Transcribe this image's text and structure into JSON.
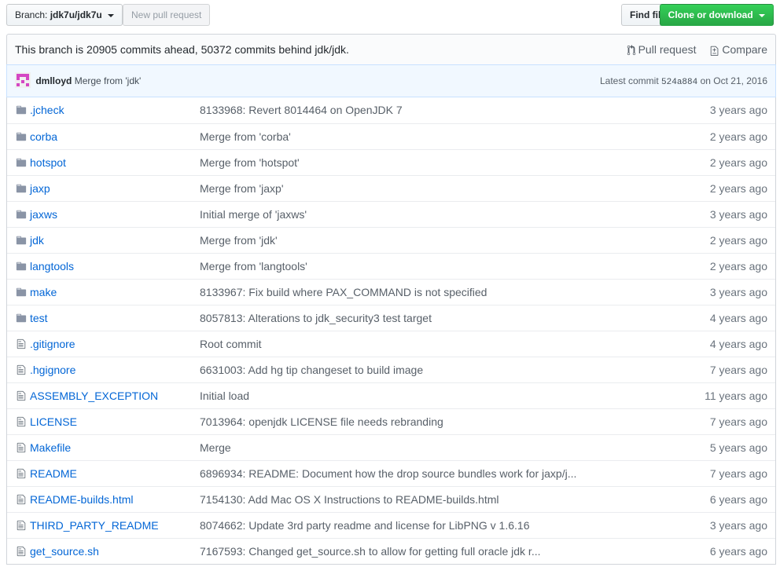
{
  "toolbar": {
    "branch_prefix": "Branch:",
    "branch_name": "jdk7u/jdk7u",
    "new_pull_request": "New pull request",
    "find_file": "Find file",
    "clone_or_download": "Clone or download"
  },
  "branch_info": {
    "text": "This branch is 20905 commits ahead, 50372 commits behind jdk/jdk.",
    "pull_request": "Pull request",
    "compare": "Compare"
  },
  "commit": {
    "author": "dmlloyd",
    "message": "Merge from 'jdk'",
    "latest_label": "Latest commit",
    "sha": "524a884",
    "date": "on Oct 21, 2016"
  },
  "files": [
    {
      "type": "folder",
      "name": ".jcheck",
      "message": "8133968: Revert 8014464 on OpenJDK 7",
      "age": "3 years ago"
    },
    {
      "type": "folder",
      "name": "corba",
      "message": "Merge from 'corba'",
      "age": "2 years ago"
    },
    {
      "type": "folder",
      "name": "hotspot",
      "message": "Merge from 'hotspot'",
      "age": "2 years ago"
    },
    {
      "type": "folder",
      "name": "jaxp",
      "message": "Merge from 'jaxp'",
      "age": "2 years ago"
    },
    {
      "type": "folder",
      "name": "jaxws",
      "message": "Initial merge of 'jaxws'",
      "age": "3 years ago"
    },
    {
      "type": "folder",
      "name": "jdk",
      "message": "Merge from 'jdk'",
      "age": "2 years ago"
    },
    {
      "type": "folder",
      "name": "langtools",
      "message": "Merge from 'langtools'",
      "age": "2 years ago"
    },
    {
      "type": "folder",
      "name": "make",
      "message": "8133967: Fix build where PAX_COMMAND is not specified",
      "age": "3 years ago"
    },
    {
      "type": "folder",
      "name": "test",
      "message": "8057813: Alterations to jdk_security3 test target",
      "age": "4 years ago"
    },
    {
      "type": "file",
      "name": ".gitignore",
      "message": "Root commit",
      "age": "4 years ago"
    },
    {
      "type": "file",
      "name": ".hgignore",
      "message": "6631003: Add hg tip changeset to build image",
      "age": "7 years ago"
    },
    {
      "type": "file",
      "name": "ASSEMBLY_EXCEPTION",
      "message": "Initial load",
      "age": "11 years ago"
    },
    {
      "type": "file",
      "name": "LICENSE",
      "message": "7013964: openjdk LICENSE file needs rebranding",
      "age": "7 years ago"
    },
    {
      "type": "file",
      "name": "Makefile",
      "message": "Merge",
      "age": "5 years ago"
    },
    {
      "type": "file",
      "name": "README",
      "message": "6896934: README: Document how the drop source bundles work for jaxp/j...",
      "age": "7 years ago"
    },
    {
      "type": "file",
      "name": "README-builds.html",
      "message": "7154130: Add Mac OS X Instructions to README-builds.html",
      "age": "6 years ago"
    },
    {
      "type": "file",
      "name": "THIRD_PARTY_README",
      "message": "8074662: Update 3rd party readme and license for LibPNG v 1.6.16",
      "age": "3 years ago"
    },
    {
      "type": "file",
      "name": "get_source.sh",
      "message": "7167593: Changed get_source.sh to allow for getting full oracle jdk r...",
      "age": "6 years ago"
    }
  ]
}
